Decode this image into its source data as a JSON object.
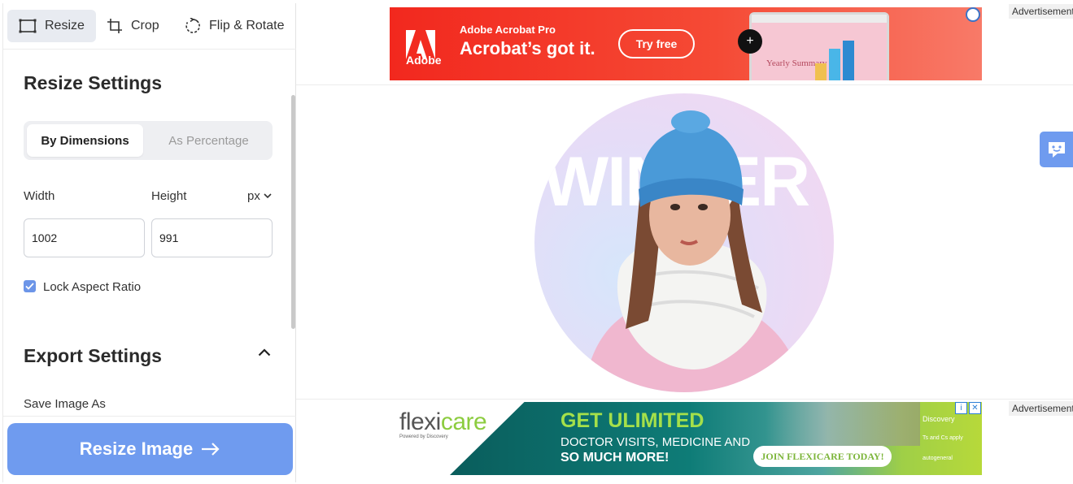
{
  "tabs": [
    {
      "label": "Resize",
      "icon": "resize-icon",
      "active": true
    },
    {
      "label": "Crop",
      "icon": "crop-icon",
      "active": false
    },
    {
      "label": "Flip & Rotate",
      "icon": "rotate-icon",
      "active": false
    }
  ],
  "resize_settings": {
    "title": "Resize Settings",
    "mode_options": [
      "By Dimensions",
      "As Percentage"
    ],
    "selected_mode": "By Dimensions",
    "width_label": "Width",
    "height_label": "Height",
    "unit": "px",
    "width_value": "1002",
    "height_value": "991",
    "lock_label": "Lock Aspect Ratio",
    "lock_checked": true
  },
  "export_settings": {
    "title": "Export Settings",
    "save_as_label": "Save Image As"
  },
  "primary_button": {
    "label": "Resize Image",
    "icon": "arrow-right-icon"
  },
  "ads": {
    "label": "Advertisement",
    "top": {
      "brand": "Adobe",
      "product": "Adobe Acrobat Pro",
      "headline": "Acrobat’s got it.",
      "cta": "Try free",
      "screen_text": "Yearly Summary"
    },
    "bottom": {
      "brand_a": "flexi",
      "brand_b": "care",
      "powered": "Powered by Discovery",
      "headline": "GET ULIMITED",
      "line2": "DOCTOR VISITS, MEDICINE AND",
      "line3": "SO MUCH MORE!",
      "cta": "JOIN FLEXICARE TODAY!",
      "discovery": "Discovery",
      "terms": "Ts and Cs apply",
      "underwriter": "autogeneral"
    }
  },
  "preview": {
    "overlay_text": "WINTER"
  },
  "colors": {
    "accent": "#6f9bef",
    "tab_active_bg": "#e8ebf1",
    "adobe_red": "#f2281e",
    "flexi_green": "#8ccc3f"
  }
}
